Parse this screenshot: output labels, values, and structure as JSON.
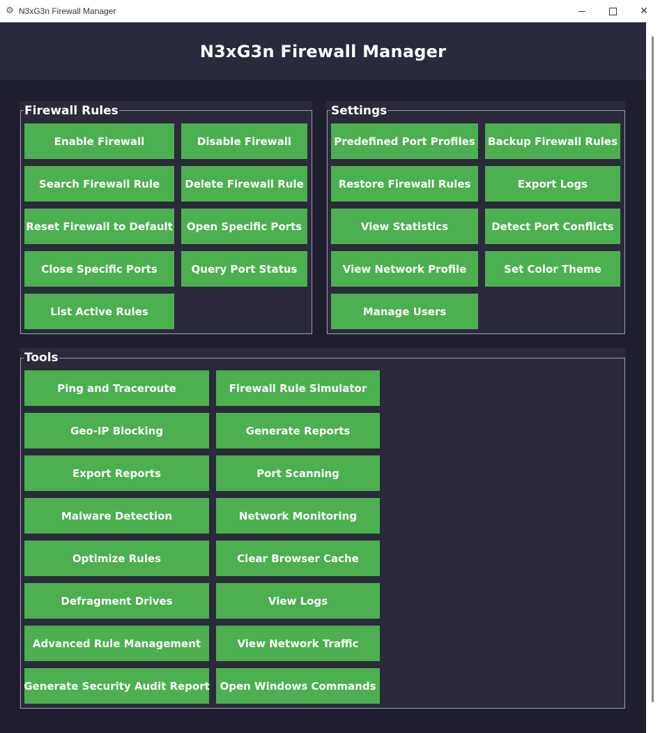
{
  "window": {
    "title": "N3xG3n Firewall Manager",
    "icon": "gear-icon",
    "controls": {
      "minimize": "minimize-icon",
      "maximize": "maximize-icon",
      "close": "✕"
    }
  },
  "header": {
    "title": "N3xG3n Firewall Manager"
  },
  "colors": {
    "background": "#1e1e2e",
    "panel": "#2b2a3b",
    "button": "#4caf50",
    "text": "#ffffff"
  },
  "firewall_rules": {
    "title": "Firewall Rules",
    "buttons": [
      "Enable Firewall",
      "Disable Firewall",
      "Search Firewall Rule",
      "Delete Firewall Rule",
      "Reset Firewall to Default",
      "Open Specific Ports",
      "Close Specific Ports",
      "Query Port Status",
      "List Active Rules"
    ]
  },
  "settings": {
    "title": "Settings",
    "buttons": [
      "Predefined Port Profiles",
      "Backup Firewall Rules",
      "Restore Firewall Rules",
      "Export Logs",
      "View Statistics",
      "Detect Port Conflicts",
      "View Network Profile",
      "Set Color Theme",
      "Manage Users"
    ]
  },
  "tools": {
    "title": "Tools",
    "buttons": [
      "Ping and Traceroute",
      "Firewall Rule Simulator",
      "Geo-IP Blocking",
      "Generate Reports",
      "Export Reports",
      "Port Scanning",
      "Malware Detection",
      "Network Monitoring",
      "Optimize Rules",
      "Clear Browser Cache",
      "Defragment Drives",
      "View Logs",
      "Advanced Rule Management",
      "View Network Traffic",
      "Generate Security Audit Report",
      "Open Windows Commands"
    ]
  }
}
